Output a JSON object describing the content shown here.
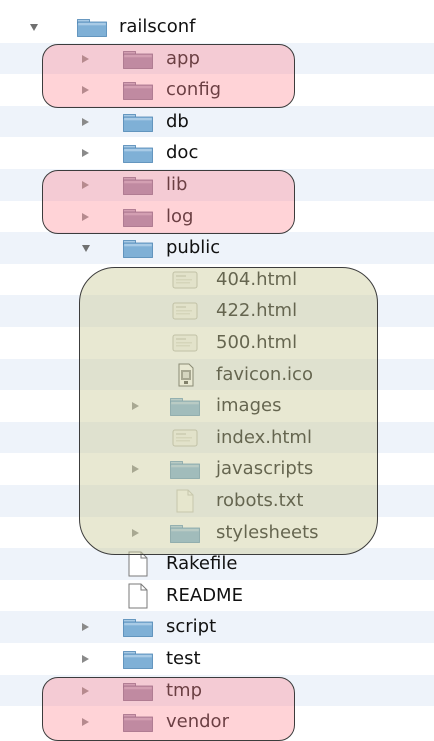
{
  "colors": {
    "row_even": "#ffffff",
    "row_odd": "#eef3fa",
    "folder": "#7aa9cf",
    "highlight_red": "#ff8c96",
    "highlight_olive": "#cdcd9b"
  },
  "tree": [
    {
      "label": "railsconf",
      "icon": "folder-icon",
      "expand": "open",
      "depth": 0
    },
    {
      "label": "app",
      "icon": "folder-icon",
      "expand": "closed",
      "depth": 1
    },
    {
      "label": "config",
      "icon": "folder-icon",
      "expand": "closed",
      "depth": 1
    },
    {
      "label": "db",
      "icon": "folder-icon",
      "expand": "closed",
      "depth": 1
    },
    {
      "label": "doc",
      "icon": "folder-icon",
      "expand": "closed",
      "depth": 1
    },
    {
      "label": "lib",
      "icon": "folder-icon",
      "expand": "closed",
      "depth": 1
    },
    {
      "label": "log",
      "icon": "folder-icon",
      "expand": "closed",
      "depth": 1
    },
    {
      "label": "public",
      "icon": "folder-icon",
      "expand": "open",
      "depth": 1
    },
    {
      "label": "404.html",
      "icon": "html-file-icon",
      "expand": "none",
      "depth": 2
    },
    {
      "label": "422.html",
      "icon": "html-file-icon",
      "expand": "none",
      "depth": 2
    },
    {
      "label": "500.html",
      "icon": "html-file-icon",
      "expand": "none",
      "depth": 2
    },
    {
      "label": "favicon.ico",
      "icon": "ico-file-icon",
      "expand": "none",
      "depth": 2
    },
    {
      "label": "images",
      "icon": "folder-icon",
      "expand": "closed",
      "depth": 2
    },
    {
      "label": "index.html",
      "icon": "html-file-icon",
      "expand": "none",
      "depth": 2
    },
    {
      "label": "javascripts",
      "icon": "folder-icon",
      "expand": "closed",
      "depth": 2
    },
    {
      "label": "robots.txt",
      "icon": "text-file-icon",
      "expand": "none",
      "depth": 2
    },
    {
      "label": "stylesheets",
      "icon": "folder-icon",
      "expand": "closed",
      "depth": 2
    },
    {
      "label": "Rakefile",
      "icon": "document-icon",
      "expand": "none",
      "depth": 1
    },
    {
      "label": "README",
      "icon": "document-icon",
      "expand": "none",
      "depth": 1
    },
    {
      "label": "script",
      "icon": "folder-icon",
      "expand": "closed",
      "depth": 1
    },
    {
      "label": "test",
      "icon": "folder-icon",
      "expand": "closed",
      "depth": 1
    },
    {
      "label": "tmp",
      "icon": "folder-icon",
      "expand": "closed",
      "depth": 1
    },
    {
      "label": "vendor",
      "icon": "folder-icon",
      "expand": "closed",
      "depth": 1
    }
  ]
}
